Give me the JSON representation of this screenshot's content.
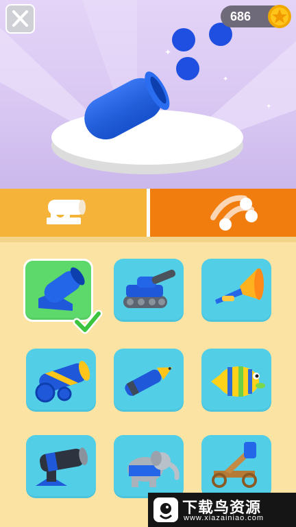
{
  "header": {
    "coins": "686",
    "close_icon": "close-icon",
    "coin_icon": "star-coin-icon"
  },
  "tabs": [
    {
      "name": "cannon-tab",
      "icon": "cannon-icon",
      "active": false
    },
    {
      "name": "ammo-tab",
      "icon": "cannonballs-icon",
      "active": true
    }
  ],
  "items": [
    {
      "name": "blue-cannon",
      "selected": true
    },
    {
      "name": "tank"
    },
    {
      "name": "trumpet"
    },
    {
      "name": "striped-cannon"
    },
    {
      "name": "pen"
    },
    {
      "name": "fish"
    },
    {
      "name": "gatling-turret"
    },
    {
      "name": "elephant"
    },
    {
      "name": "catapult-cart"
    }
  ],
  "watermark": {
    "title": "下载鸟资源",
    "url": "www.xiazainiao.com"
  },
  "colors": {
    "item_tile": "#52cfe7",
    "selected_tile": "#5dd86a",
    "active_tab": "#f27d0f",
    "inactive_tab": "#f5b33a"
  }
}
